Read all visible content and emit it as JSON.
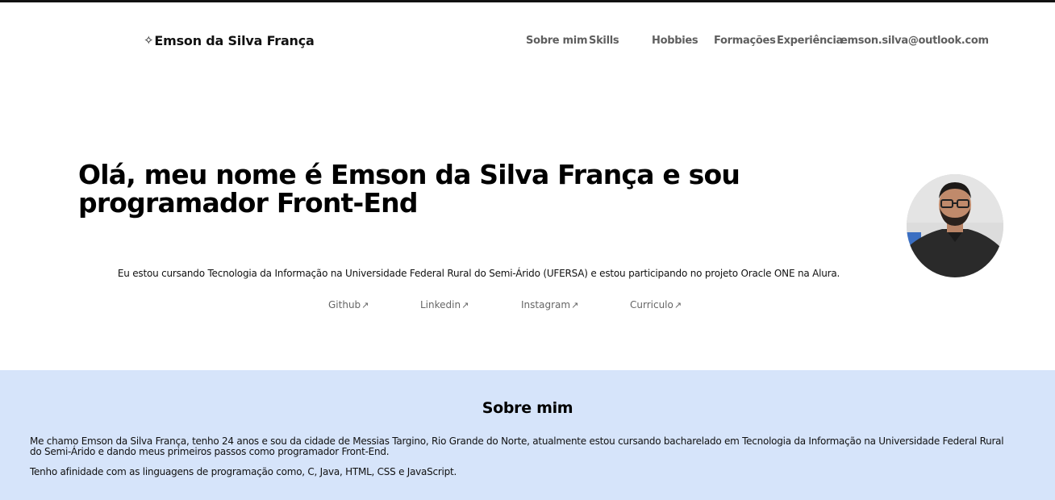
{
  "header": {
    "brand_icon": "sparkles-icon",
    "brand_name": "Emson da Silva França",
    "nav": [
      {
        "label": "Sobre mim"
      },
      {
        "label": "Skills"
      },
      {
        "label": "Hobbies"
      },
      {
        "label": "Formações"
      },
      {
        "label": "Experiência"
      },
      {
        "label": "emson.silva@outlook.com"
      }
    ]
  },
  "hero": {
    "title": "Olá, meu nome é Emson da Silva França e sou programador Front-End",
    "description": "Eu estou cursando Tecnologia da Informação na Universidade Federal Rural do Semi-Árido (UFERSA) e estou participando no projeto Oracle ONE na Alura.",
    "links": [
      {
        "label": "Github"
      },
      {
        "label": "Linkedin"
      },
      {
        "label": "Instagram"
      },
      {
        "label": "Curriculo"
      }
    ],
    "link_arrow": "↗"
  },
  "about": {
    "title": "Sobre mim",
    "paragraph1": "Me chamo Emson da Silva França, tenho 24 anos e sou da cidade de Messias Targino, Rio Grande do Norte, atualmente estou cursando bacharelado em Tecnologia da Informação na Universidade Federal Rural do Semi-Árido e dando meus primeiros passos como programador Front-End.",
    "paragraph2": "Tenho afinidade com as linguagens de programação como, C, Java, HTML, CSS e JavaScript."
  },
  "colors": {
    "about_background": "#d6e4fa",
    "nav_text": "#5f5f5f",
    "top_border": "#111111"
  }
}
